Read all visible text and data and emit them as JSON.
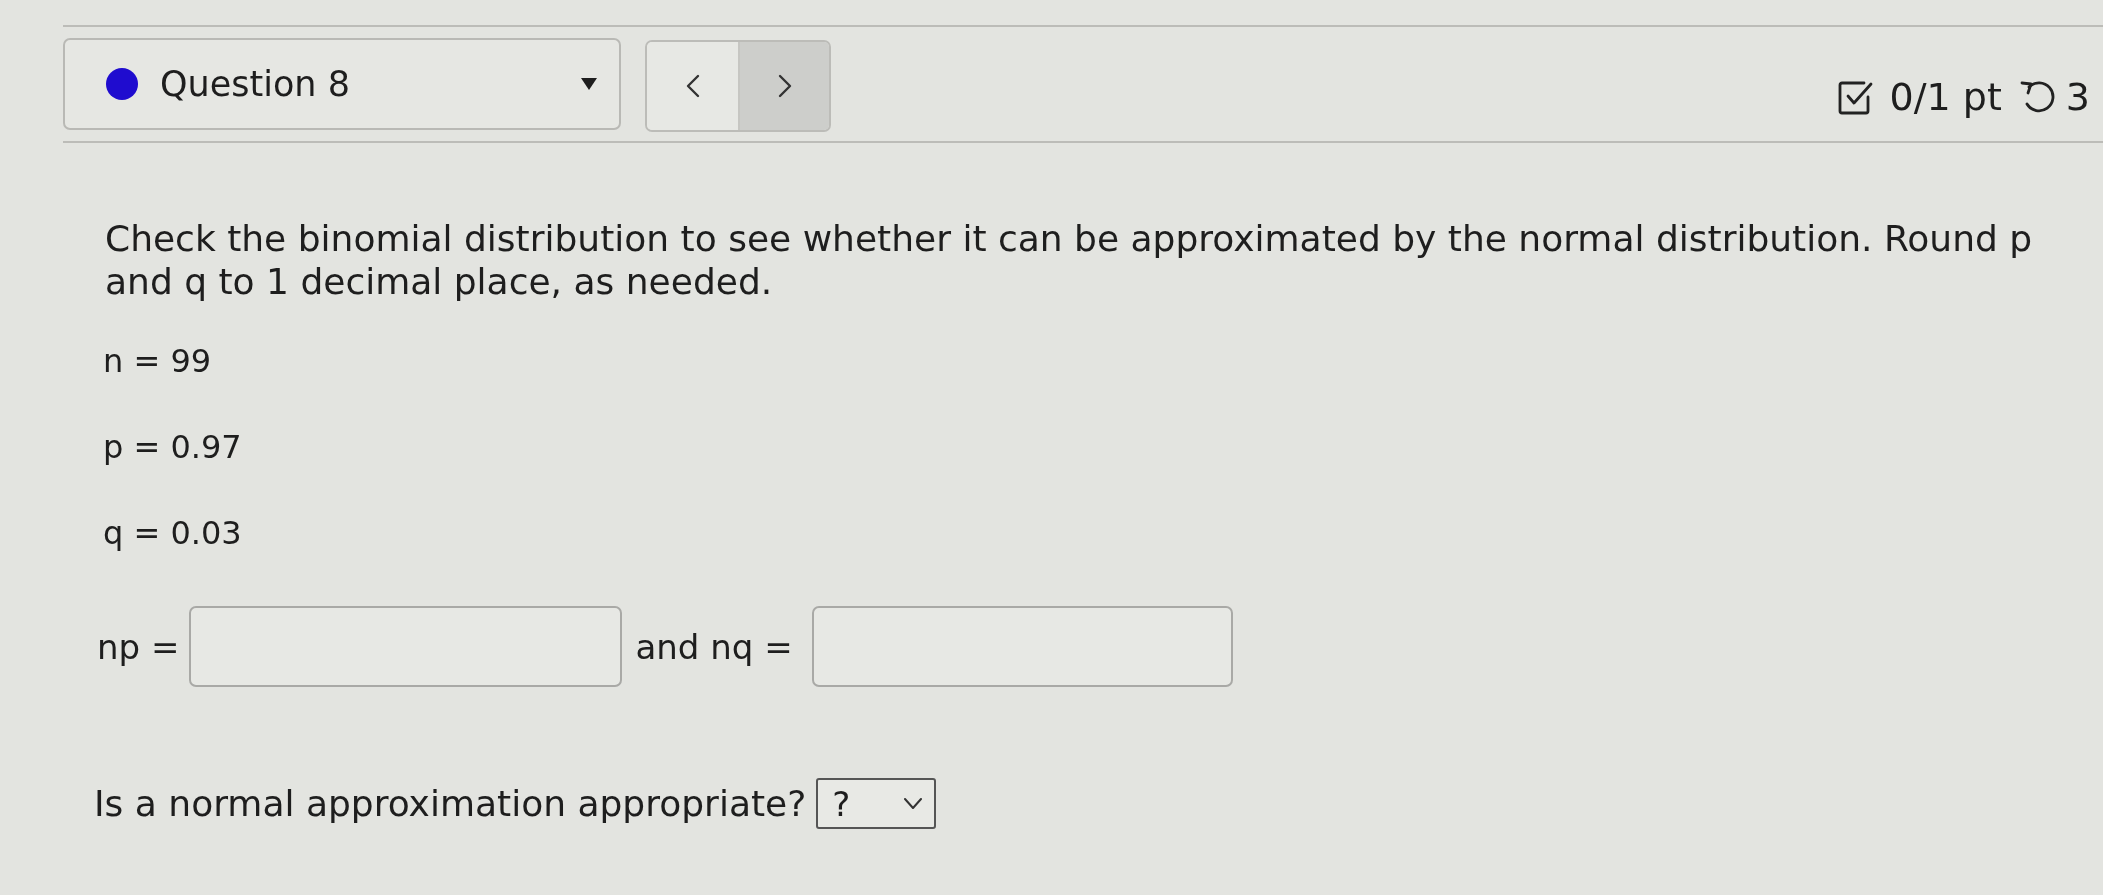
{
  "question_nav": {
    "title": "Question 8",
    "nav_buttons": [
      {
        "kind": "previous",
        "highlighted": false
      },
      {
        "kind": "next",
        "highlighted": true
      }
    ]
  },
  "score": {
    "points": "0/1 pt",
    "attempts": "3"
  },
  "question": {
    "prompt": "Check the binomial distribution to see whether it can be approximated by the normal distribution. Round p and q to 1 decimal place, as needed.",
    "givens": [
      "n = 99",
      "p = 0.97",
      "q = 0.03"
    ],
    "answers": [
      {
        "label": "np ="
      },
      {
        "label": "and nq ="
      }
    ],
    "approximation": {
      "label": "Is a normal approximation appropriate?",
      "value": "?"
    }
  }
}
